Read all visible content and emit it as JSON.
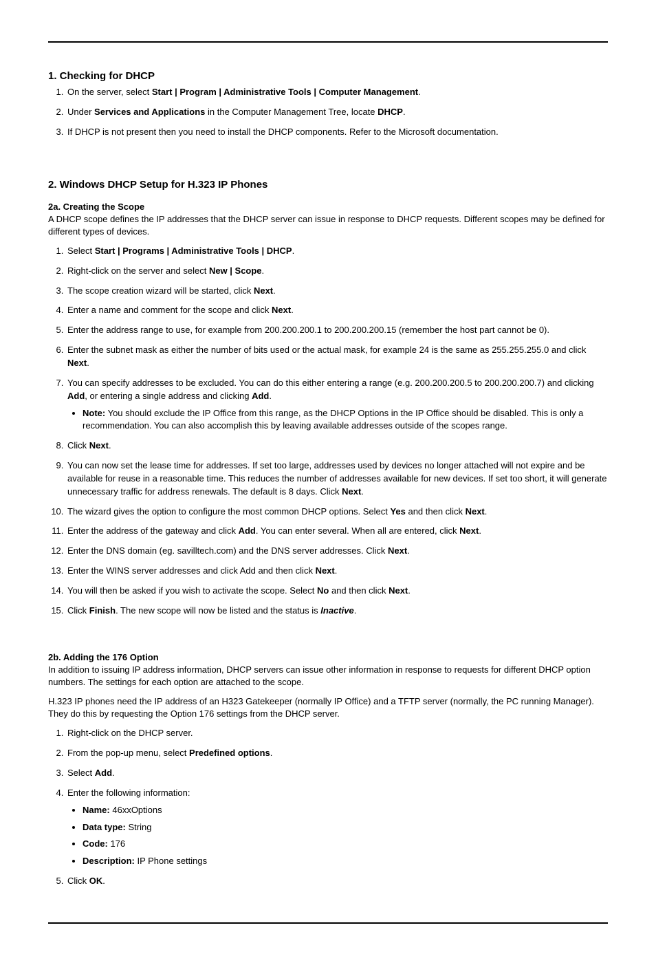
{
  "section1": {
    "title": "1. Checking for DHCP",
    "items": [
      {
        "pre": "On the server, select ",
        "b1": "Start | Program | Administrative Tools | Computer Management",
        "post1": "."
      },
      {
        "pre": "Under ",
        "b1": "Services and Applications",
        "mid": " in the Computer Management Tree, locate ",
        "b2": "DHCP",
        "post": "."
      },
      {
        "text": "If DHCP is not present then you need to install the DHCP components. Refer to the Microsoft documentation."
      }
    ]
  },
  "section2": {
    "title": "2. Windows DHCP Setup for H.323 IP Phones",
    "sub_a": {
      "title": "2a. Creating the Scope",
      "intro": "A DHCP scope defines the IP addresses that the DHCP server can issue in response to DHCP requests.  Different scopes may be defined for different types of devices.",
      "items": {
        "i1": {
          "pre": "Select ",
          "b1": "Start | Programs | Administrative Tools | DHCP",
          "post": "."
        },
        "i2": {
          "pre": "Right-click on the server and select ",
          "b1": "New | Scope",
          "post": "."
        },
        "i3": {
          "pre": "The scope creation wizard will be started, click ",
          "b1": "Next",
          "post": "."
        },
        "i4": {
          "pre": "Enter a name and comment for the scope and click ",
          "b1": "Next",
          "post": "."
        },
        "i5": {
          "text": "Enter the address range to use, for example from 200.200.200.1 to 200.200.200.15 (remember the host part cannot be 0)."
        },
        "i6": {
          "pre": "Enter the subnet mask as either the number of bits used or the actual mask, for example 24 is the same as 255.255.255.0 and click ",
          "b1": "Next",
          "post": "."
        },
        "i7": {
          "pre": "You can specify addresses to be excluded. You can do this either entering a range (e.g. 200.200.200.5 to 200.200.200.7) and clicking ",
          "b1": "Add",
          "mid": ", or entering a single address and clicking ",
          "b2": "Add",
          "post": ".",
          "note": {
            "b": "Note:",
            "text": " You should exclude the IP Office from this range, as the DHCP Options in the IP Office should be disabled. This is only a recommendation. You can also accomplish this by leaving available addresses outside of the scopes range."
          }
        },
        "i8": {
          "pre": "Click ",
          "b1": "Next",
          "post": "."
        },
        "i9": {
          "pre": "You can now set the lease time for addresses. If set too large, addresses used by devices no longer attached will not expire and be available for reuse in a reasonable time. This reduces the number of addresses available for new devices. If set too short, it will generate unnecessary traffic for address renewals. The default is 8 days. Click ",
          "b1": "Next",
          "post": "."
        },
        "i10": {
          "pre": "The wizard gives the option to configure the most common DHCP options. Select ",
          "b1": "Yes",
          "mid": " and then click ",
          "b2": "Next",
          "post": "."
        },
        "i11": {
          "pre": "Enter the address of the gateway and click ",
          "b1": "Add",
          "mid": ". You can enter several. When all are entered, click ",
          "b2": "Next",
          "post": "."
        },
        "i12": {
          "pre": "Enter the DNS domain (eg. savilltech.com) and the DNS server addresses. Click ",
          "b1": "Next",
          "post": "."
        },
        "i13": {
          "pre": "Enter the WINS server addresses and click Add and then click ",
          "b1": "Next",
          "post": "."
        },
        "i14": {
          "pre": "You will then be asked if you wish to activate the scope. Select ",
          "b1": "No",
          "mid": " and then click ",
          "b2": "Next",
          "post": "."
        },
        "i15": {
          "pre": "Click ",
          "b1": "Finish",
          "mid": ". The new scope will now be listed and the status is ",
          "bi": "Inactive",
          "post": "."
        }
      }
    },
    "sub_b": {
      "title": "2b. Adding the 176 Option",
      "intro1": "In addition to issuing IP address information, DHCP servers can issue other information in response to requests for different DHCP option numbers. The settings for each option are attached to the scope.",
      "intro2": "H.323 IP phones need the IP address of an H323 Gatekeeper (normally IP Office) and a TFTP server (normally, the PC running Manager). They do this by requesting the Option 176 settings from the DHCP server.",
      "items": {
        "i1": {
          "text": "Right-click on the DHCP server."
        },
        "i2": {
          "pre": "From the pop-up menu, select ",
          "b1": "Predefined options",
          "post": "."
        },
        "i3": {
          "pre": "Select ",
          "b1": "Add",
          "post": "."
        },
        "i4": {
          "text": "Enter the following information:",
          "sub": {
            "s1": {
              "b": "Name:",
              "v": " 46xxOptions"
            },
            "s2": {
              "b": "Data type:",
              "v": " String"
            },
            "s3": {
              "b": "Code:",
              "v": " 176"
            },
            "s4": {
              "b": "Description:",
              "v": " IP Phone settings"
            }
          }
        },
        "i5": {
          "pre": "Click ",
          "b1": "OK",
          "post": "."
        }
      }
    }
  }
}
